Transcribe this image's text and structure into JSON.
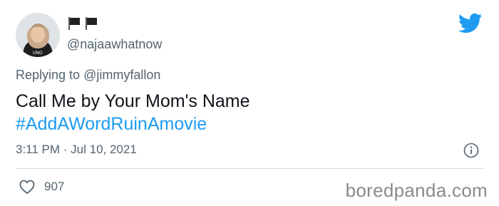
{
  "author": {
    "display_name_icons": [
      "black-flag-icon",
      "black-flag-icon"
    ],
    "handle": "@najaawhatnow"
  },
  "tweet": {
    "replying_prefix": "Replying to ",
    "replying_to": "@jimmyfallon",
    "text": "Call Me by Your Mom's Name",
    "hashtag": "#AddAWordRuinAmovie",
    "timestamp": "3:11 PM · Jul 10, 2021"
  },
  "engagement": {
    "likes": "907"
  },
  "watermark": "boredpanda.com",
  "colors": {
    "accent": "#1d9bf0",
    "muted": "#536471",
    "text": "#0f1419"
  }
}
